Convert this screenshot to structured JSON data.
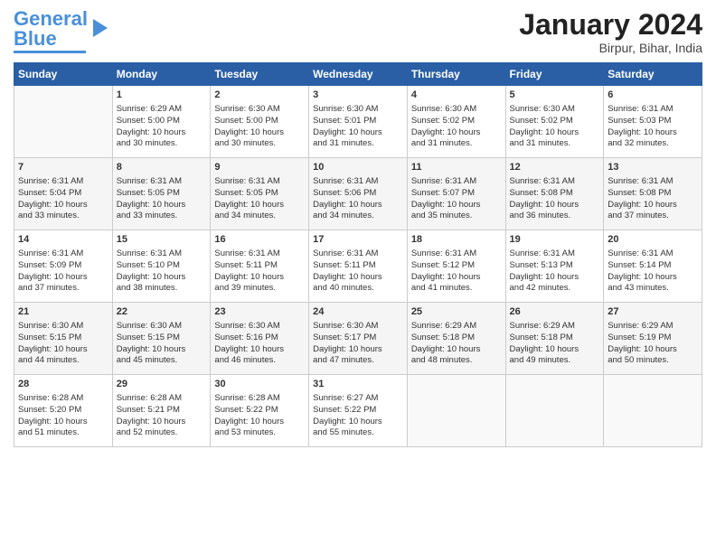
{
  "logo": {
    "line1": "General",
    "line2": "Blue"
  },
  "title": "January 2024",
  "location": "Birpur, Bihar, India",
  "days_of_week": [
    "Sunday",
    "Monday",
    "Tuesday",
    "Wednesday",
    "Thursday",
    "Friday",
    "Saturday"
  ],
  "weeks": [
    [
      {
        "day": "",
        "data": ""
      },
      {
        "day": "1",
        "data": "Sunrise: 6:29 AM\nSunset: 5:00 PM\nDaylight: 10 hours\nand 30 minutes."
      },
      {
        "day": "2",
        "data": "Sunrise: 6:30 AM\nSunset: 5:00 PM\nDaylight: 10 hours\nand 30 minutes."
      },
      {
        "day": "3",
        "data": "Sunrise: 6:30 AM\nSunset: 5:01 PM\nDaylight: 10 hours\nand 31 minutes."
      },
      {
        "day": "4",
        "data": "Sunrise: 6:30 AM\nSunset: 5:02 PM\nDaylight: 10 hours\nand 31 minutes."
      },
      {
        "day": "5",
        "data": "Sunrise: 6:30 AM\nSunset: 5:02 PM\nDaylight: 10 hours\nand 31 minutes."
      },
      {
        "day": "6",
        "data": "Sunrise: 6:31 AM\nSunset: 5:03 PM\nDaylight: 10 hours\nand 32 minutes."
      }
    ],
    [
      {
        "day": "7",
        "data": "Sunrise: 6:31 AM\nSunset: 5:04 PM\nDaylight: 10 hours\nand 33 minutes."
      },
      {
        "day": "8",
        "data": "Sunrise: 6:31 AM\nSunset: 5:05 PM\nDaylight: 10 hours\nand 33 minutes."
      },
      {
        "day": "9",
        "data": "Sunrise: 6:31 AM\nSunset: 5:05 PM\nDaylight: 10 hours\nand 34 minutes."
      },
      {
        "day": "10",
        "data": "Sunrise: 6:31 AM\nSunset: 5:06 PM\nDaylight: 10 hours\nand 34 minutes."
      },
      {
        "day": "11",
        "data": "Sunrise: 6:31 AM\nSunset: 5:07 PM\nDaylight: 10 hours\nand 35 minutes."
      },
      {
        "day": "12",
        "data": "Sunrise: 6:31 AM\nSunset: 5:08 PM\nDaylight: 10 hours\nand 36 minutes."
      },
      {
        "day": "13",
        "data": "Sunrise: 6:31 AM\nSunset: 5:08 PM\nDaylight: 10 hours\nand 37 minutes."
      }
    ],
    [
      {
        "day": "14",
        "data": "Sunrise: 6:31 AM\nSunset: 5:09 PM\nDaylight: 10 hours\nand 37 minutes."
      },
      {
        "day": "15",
        "data": "Sunrise: 6:31 AM\nSunset: 5:10 PM\nDaylight: 10 hours\nand 38 minutes."
      },
      {
        "day": "16",
        "data": "Sunrise: 6:31 AM\nSunset: 5:11 PM\nDaylight: 10 hours\nand 39 minutes."
      },
      {
        "day": "17",
        "data": "Sunrise: 6:31 AM\nSunset: 5:11 PM\nDaylight: 10 hours\nand 40 minutes."
      },
      {
        "day": "18",
        "data": "Sunrise: 6:31 AM\nSunset: 5:12 PM\nDaylight: 10 hours\nand 41 minutes."
      },
      {
        "day": "19",
        "data": "Sunrise: 6:31 AM\nSunset: 5:13 PM\nDaylight: 10 hours\nand 42 minutes."
      },
      {
        "day": "20",
        "data": "Sunrise: 6:31 AM\nSunset: 5:14 PM\nDaylight: 10 hours\nand 43 minutes."
      }
    ],
    [
      {
        "day": "21",
        "data": "Sunrise: 6:30 AM\nSunset: 5:15 PM\nDaylight: 10 hours\nand 44 minutes."
      },
      {
        "day": "22",
        "data": "Sunrise: 6:30 AM\nSunset: 5:15 PM\nDaylight: 10 hours\nand 45 minutes."
      },
      {
        "day": "23",
        "data": "Sunrise: 6:30 AM\nSunset: 5:16 PM\nDaylight: 10 hours\nand 46 minutes."
      },
      {
        "day": "24",
        "data": "Sunrise: 6:30 AM\nSunset: 5:17 PM\nDaylight: 10 hours\nand 47 minutes."
      },
      {
        "day": "25",
        "data": "Sunrise: 6:29 AM\nSunset: 5:18 PM\nDaylight: 10 hours\nand 48 minutes."
      },
      {
        "day": "26",
        "data": "Sunrise: 6:29 AM\nSunset: 5:18 PM\nDaylight: 10 hours\nand 49 minutes."
      },
      {
        "day": "27",
        "data": "Sunrise: 6:29 AM\nSunset: 5:19 PM\nDaylight: 10 hours\nand 50 minutes."
      }
    ],
    [
      {
        "day": "28",
        "data": "Sunrise: 6:28 AM\nSunset: 5:20 PM\nDaylight: 10 hours\nand 51 minutes."
      },
      {
        "day": "29",
        "data": "Sunrise: 6:28 AM\nSunset: 5:21 PM\nDaylight: 10 hours\nand 52 minutes."
      },
      {
        "day": "30",
        "data": "Sunrise: 6:28 AM\nSunset: 5:22 PM\nDaylight: 10 hours\nand 53 minutes."
      },
      {
        "day": "31",
        "data": "Sunrise: 6:27 AM\nSunset: 5:22 PM\nDaylight: 10 hours\nand 55 minutes."
      },
      {
        "day": "",
        "data": ""
      },
      {
        "day": "",
        "data": ""
      },
      {
        "day": "",
        "data": ""
      }
    ]
  ]
}
